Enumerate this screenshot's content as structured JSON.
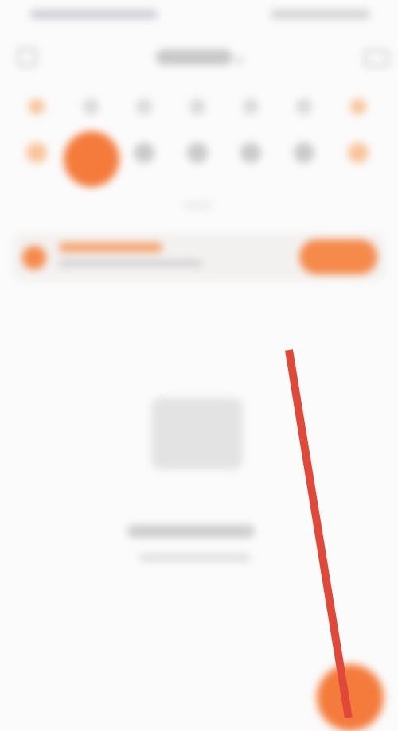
{
  "colors": {
    "accent": "#f47b3c",
    "accent_light": "#f58a4b",
    "weekend_tint": "#f8c49c",
    "placeholder_gray": "#cacaca",
    "background": "#fbfbfb",
    "annotation_stroke": "#e0483a"
  },
  "icons": {
    "back": "back-icon",
    "dropdown": "chevron-down-icon",
    "menu": "menu-icon",
    "add": "plus-icon",
    "banner": "notice-icon",
    "empty": "empty-illustration-icon"
  },
  "calendar": {
    "selected_index": 1,
    "weekend_indices": [
      0,
      6
    ]
  },
  "annotation": {
    "type": "line"
  }
}
